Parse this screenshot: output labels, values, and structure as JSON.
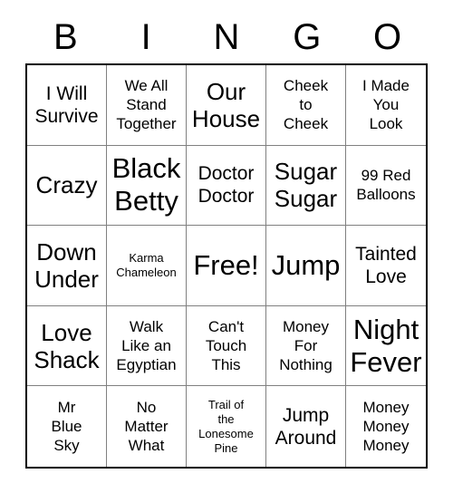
{
  "card": {
    "title": "Bingo Card",
    "header_letters": [
      "B",
      "I",
      "N",
      "G",
      "O"
    ],
    "grid_size": "5x5",
    "colors": {
      "background": "#ffffff",
      "text": "#000000",
      "outer_border": "#000000",
      "inner_grid_line": "#808080"
    },
    "rows": [
      [
        {
          "text": "I Will\nSurvive",
          "size": "sz-lg"
        },
        {
          "text": "We All\nStand\nTogether",
          "size": "sz-md"
        },
        {
          "text": "Our\nHouse",
          "size": "sz-xl"
        },
        {
          "text": "Cheek\nto\nCheek",
          "size": "sz-md"
        },
        {
          "text": "I Made\nYou\nLook",
          "size": "sz-md"
        }
      ],
      [
        {
          "text": "Crazy",
          "size": "sz-xl"
        },
        {
          "text": "Black\nBetty",
          "size": "sz-xxl"
        },
        {
          "text": "Doctor\nDoctor",
          "size": "sz-lg"
        },
        {
          "text": "Sugar\nSugar",
          "size": "sz-xl"
        },
        {
          "text": "99 Red\nBalloons",
          "size": "sz-md"
        }
      ],
      [
        {
          "text": "Down\nUnder",
          "size": "sz-xl"
        },
        {
          "text": "Karma\nChameleon",
          "size": "sz-xs"
        },
        {
          "text": "Free!",
          "size": "sz-xxl"
        },
        {
          "text": "Jump",
          "size": "sz-xxl"
        },
        {
          "text": "Tainted\nLove",
          "size": "sz-lg"
        }
      ],
      [
        {
          "text": "Love\nShack",
          "size": "sz-xl"
        },
        {
          "text": "Walk\nLike an\nEgyptian",
          "size": "sz-md"
        },
        {
          "text": "Can't\nTouch\nThis",
          "size": "sz-md"
        },
        {
          "text": "Money\nFor\nNothing",
          "size": "sz-md"
        },
        {
          "text": "Night\nFever",
          "size": "sz-xxl"
        }
      ],
      [
        {
          "text": "Mr\nBlue\nSky",
          "size": "sz-md"
        },
        {
          "text": "No\nMatter\nWhat",
          "size": "sz-md"
        },
        {
          "text": "Trail of\nthe\nLonesome\nPine",
          "size": "sz-xs"
        },
        {
          "text": "Jump\nAround",
          "size": "sz-lg"
        },
        {
          "text": "Money\nMoney\nMoney",
          "size": "sz-md"
        }
      ]
    ]
  }
}
